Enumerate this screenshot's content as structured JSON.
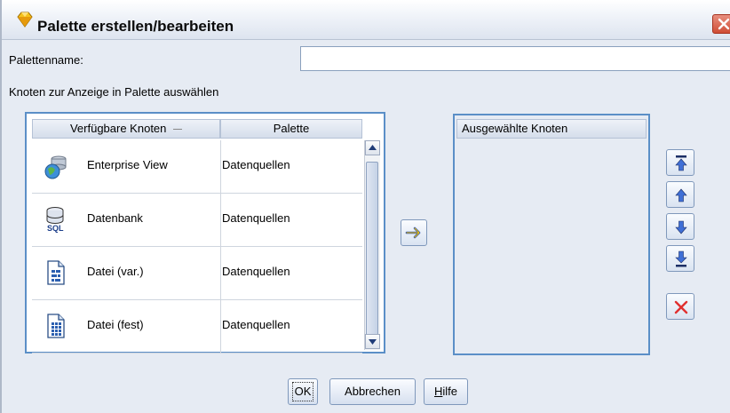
{
  "window": {
    "title": "Palette erstellen/bearbeiten"
  },
  "form": {
    "palette_name_label": "Palettenname:",
    "palette_name_value": "",
    "select_nodes_label": "Knoten zur Anzeige in Palette auswählen"
  },
  "available_table": {
    "columns": [
      "Verfügbare Knoten",
      "Palette"
    ],
    "rows": [
      {
        "name": "Enterprise View",
        "palette": "Datenquellen",
        "icon": "enterprise-view-icon"
      },
      {
        "name": "Datenbank",
        "palette": "Datenquellen",
        "icon": "database-sql-icon"
      },
      {
        "name": "Datei (var.)",
        "palette": "Datenquellen",
        "icon": "var-file-icon"
      },
      {
        "name": "Datei (fest)",
        "palette": "Datenquellen",
        "icon": "fixed-file-icon"
      }
    ]
  },
  "selected_table": {
    "header": "Ausgewählte Knoten"
  },
  "buttons": {
    "ok": "OK",
    "cancel": "Abbrechen",
    "help_prefix": "H",
    "help_rest": "ilfe"
  },
  "colors": {
    "accent": "#5b8fc7",
    "move_arrow": "#3f6fd6",
    "delete_x": "#e03030",
    "add_arrow": "#f2c200"
  }
}
